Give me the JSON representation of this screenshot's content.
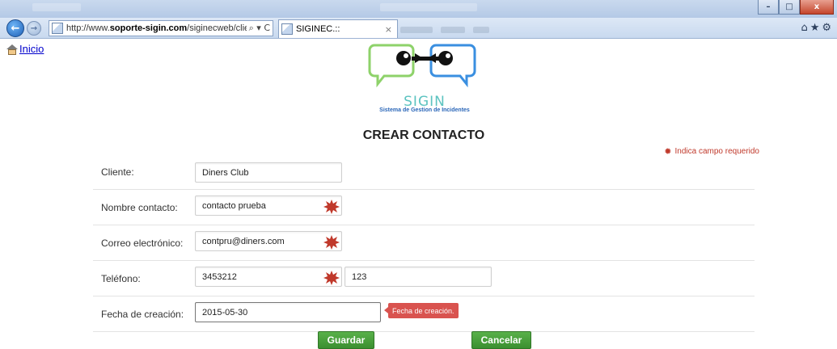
{
  "browser": {
    "address_url_prefix": "http://www.",
    "address_url_domain": "soporte-sigin.com",
    "address_url_path": "/siginecweb/cliente/cre",
    "address_tools": "⌕ ▾ C",
    "tab_title": "SIGINEC.::",
    "tab_close": "×",
    "right_tools": "⌂★⚙",
    "window_controls": [
      "–",
      "□",
      "x"
    ]
  },
  "nav": {
    "home_label": "Inicio"
  },
  "logo": {
    "word": "SIGIN",
    "subtitle": "Sistema de Gestion de Incidentes"
  },
  "page": {
    "title": "CREAR CONTACTO",
    "required_note": "Indica campo requerido",
    "required_symbol": "✹"
  },
  "form": {
    "cliente": {
      "label": "Cliente:",
      "value": "Diners Club"
    },
    "nombre": {
      "label": "Nombre contacto:",
      "value": "contacto prueba"
    },
    "correo": {
      "label": "Correo electrónico:",
      "value": "contpru@diners.com"
    },
    "telefono": {
      "label": "Teléfono:",
      "value": "3453212",
      "ext_value": "123"
    },
    "fecha": {
      "label": "Fecha de creación:",
      "value": "2015-05-30",
      "tooltip": "Fecha de creación."
    }
  },
  "actions": {
    "save_label": "Guardar",
    "cancel_label": "Cancelar"
  },
  "colors": {
    "button_green": "#4aa03d",
    "required_red": "#c0392b",
    "logo_green": "#8ed26a",
    "logo_blue": "#3a8fe0"
  }
}
